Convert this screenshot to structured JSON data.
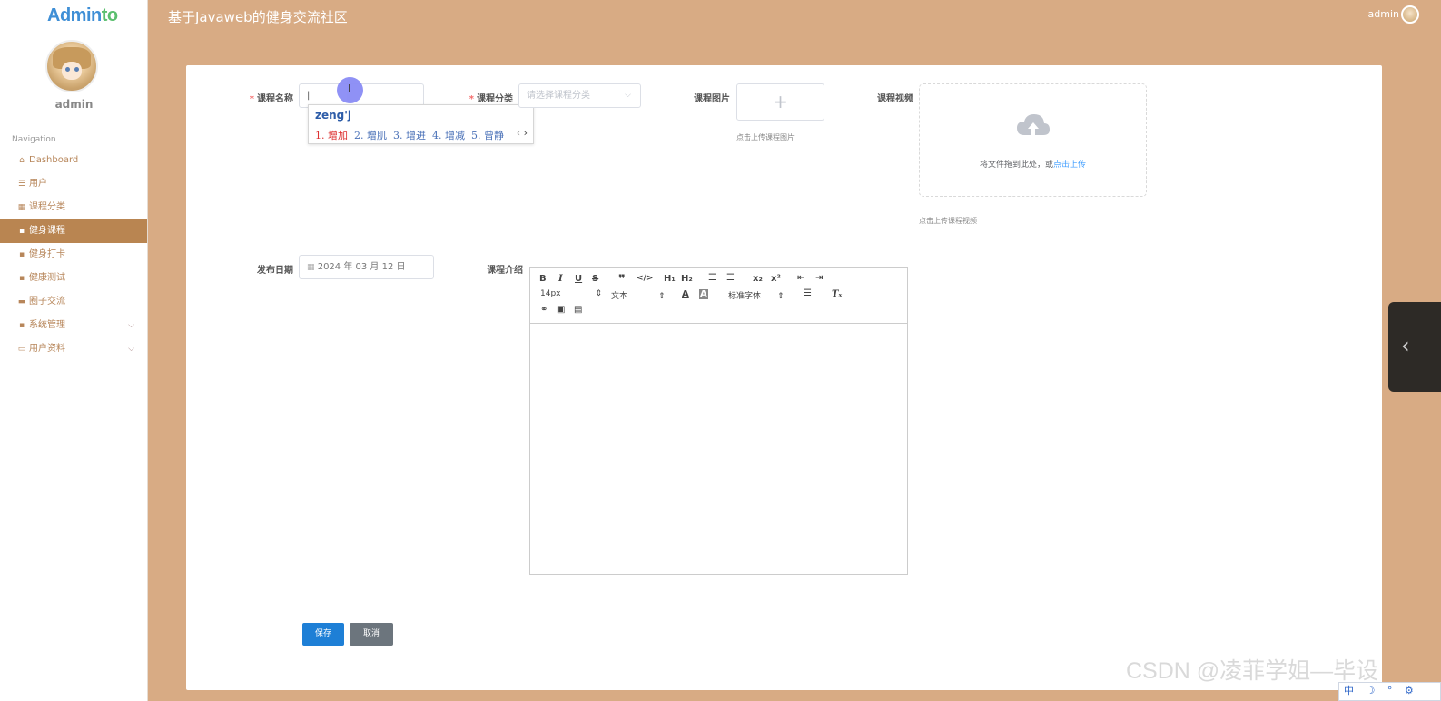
{
  "app": {
    "logo_part1": "Admin",
    "logo_part2": "to",
    "header_title": "基于Javaweb的健身交流社区",
    "header_user": "admin"
  },
  "sidebar": {
    "username": "admin",
    "nav_title": "Navigation",
    "items": [
      {
        "label": "Dashboard",
        "icon": "home-icon",
        "glyph": "⌂"
      },
      {
        "label": "用户",
        "icon": "list-icon",
        "glyph": "☰"
      },
      {
        "label": "课程分类",
        "icon": "grid-icon",
        "glyph": "▦"
      },
      {
        "label": "健身课程",
        "icon": "apps-icon",
        "glyph": "▪",
        "active": true
      },
      {
        "label": "健身打卡",
        "icon": "apps-icon",
        "glyph": "▪"
      },
      {
        "label": "健康测试",
        "icon": "apps-icon",
        "glyph": "▪"
      },
      {
        "label": "圈子交流",
        "icon": "briefcase-icon",
        "glyph": "▬"
      },
      {
        "label": "系统管理",
        "icon": "apps-icon",
        "glyph": "▪",
        "expandable": true
      },
      {
        "label": "用户资料",
        "icon": "card-icon",
        "glyph": "▭",
        "expandable": true
      }
    ]
  },
  "form": {
    "course_name_label": "课程名称",
    "course_name_value": "|",
    "category_label": "课程分类",
    "category_placeholder": "请选择课程分类",
    "image_label": "课程图片",
    "image_hint": "点击上传课程图片",
    "video_label": "课程视频",
    "video_drag_text": "将文件拖到此处，或",
    "video_drag_link": "点击上传",
    "video_hint": "点击上传课程视频",
    "date_label": "发布日期",
    "date_value": "2024 年 03 月 12 日",
    "intro_label": "课程介绍",
    "save_label": "保存",
    "cancel_label": "取消"
  },
  "ime": {
    "composition": "zeng'j",
    "candidates": [
      "1. 增加",
      "2. 增肌",
      "3. 增进",
      "4. 增减",
      "5. 曾静"
    ]
  },
  "editor": {
    "font_size": "14px",
    "block_type": "文本",
    "font_family": "标准字体"
  },
  "watermark": "CSDN @凌菲学姐—毕设",
  "tray": "中 ☽ ° ⚙"
}
